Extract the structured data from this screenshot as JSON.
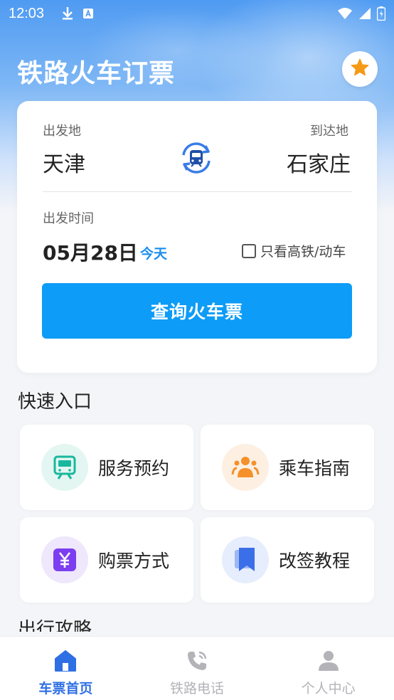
{
  "status_bar": {
    "time": "12:03"
  },
  "header": {
    "title": "铁路火车订票"
  },
  "search": {
    "from_label": "出发地",
    "from_city": "天津",
    "to_label": "到达地",
    "to_city": "石家庄",
    "date_label": "出发时间",
    "date_value": "05月28日",
    "today_label": "今天",
    "hsr_only_label": "只看高铁/动车",
    "hsr_only_checked": false,
    "search_button_label": "查询火车票"
  },
  "quick_entry": {
    "title": "快速入口",
    "tiles": [
      {
        "label": "服务预约",
        "icon": "train-screen-icon",
        "color": "#19b89d"
      },
      {
        "label": "乘车指南",
        "icon": "passenger-group-icon",
        "color": "#f5902b"
      },
      {
        "label": "购票方式",
        "icon": "yuan-icon",
        "color": "#7c3ef0"
      },
      {
        "label": "改签教程",
        "icon": "bookmark-icon",
        "color": "#3b6ee9"
      }
    ]
  },
  "next_section": {
    "title": "出行攻略"
  },
  "bottom_nav": {
    "items": [
      {
        "label": "车票首页",
        "active": true
      },
      {
        "label": "铁路电话",
        "active": false
      },
      {
        "label": "个人中心",
        "active": false
      }
    ]
  },
  "colors": {
    "accent": "#0d9cf7",
    "nav_active": "#2f6fe4",
    "star": "#f59a16"
  }
}
